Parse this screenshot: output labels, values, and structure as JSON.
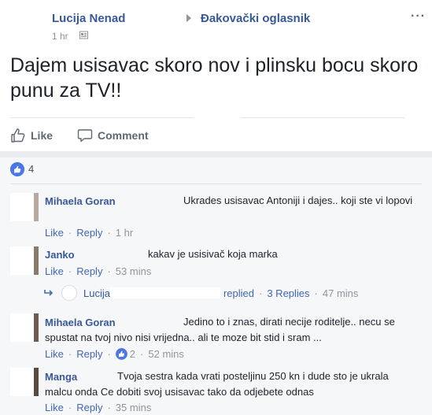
{
  "post": {
    "author": "Lucija Nenad",
    "group": "Đakovački oglasnik",
    "time": "1 hr",
    "more": "···",
    "status": "Dajem usisavac skoro nov i plinsku bocu skoro punu za TV!!",
    "actions": {
      "like": "Like",
      "comment": "Comment"
    },
    "reactions_count": "4"
  },
  "comments": [
    {
      "name": "Mihaela Goran",
      "text": "Ukrades usisavac Antoniji i dajes.. koji ste vi lopovi",
      "like": "Like",
      "reply": "Reply",
      "time": "1 hr"
    },
    {
      "name": "Janko",
      "text": "kakav je usisivač koja marka",
      "like": "Like",
      "reply": "Reply",
      "time": "53 mins",
      "replies": {
        "name": "Lucija",
        "replied": "replied",
        "count_label": "3 Replies",
        "time": "47 mins"
      }
    },
    {
      "name": "Mihaela Goran",
      "text": "Jedino to i znas, dirati necije roditelje.. necu se spustat na tvoj nivo nisi vrijedna.. ali te moze bit stid i sram ...",
      "like": "Like",
      "reply": "Reply",
      "likes": "2",
      "time": "52 mins"
    },
    {
      "name": "Manga",
      "text": "Tvoja sestra kada vrati posteljinu 250 kn i dude sto je ukrala malcu onda Ce dobiti svoj usisavac tako da odjebete odnas",
      "like": "Like",
      "reply": "Reply",
      "time": "35 mins"
    }
  ],
  "colors": {
    "link": "#365899",
    "meta": "#90949c",
    "like_blue": "#4a76e8",
    "comment_bg": "#f6f7f9"
  }
}
